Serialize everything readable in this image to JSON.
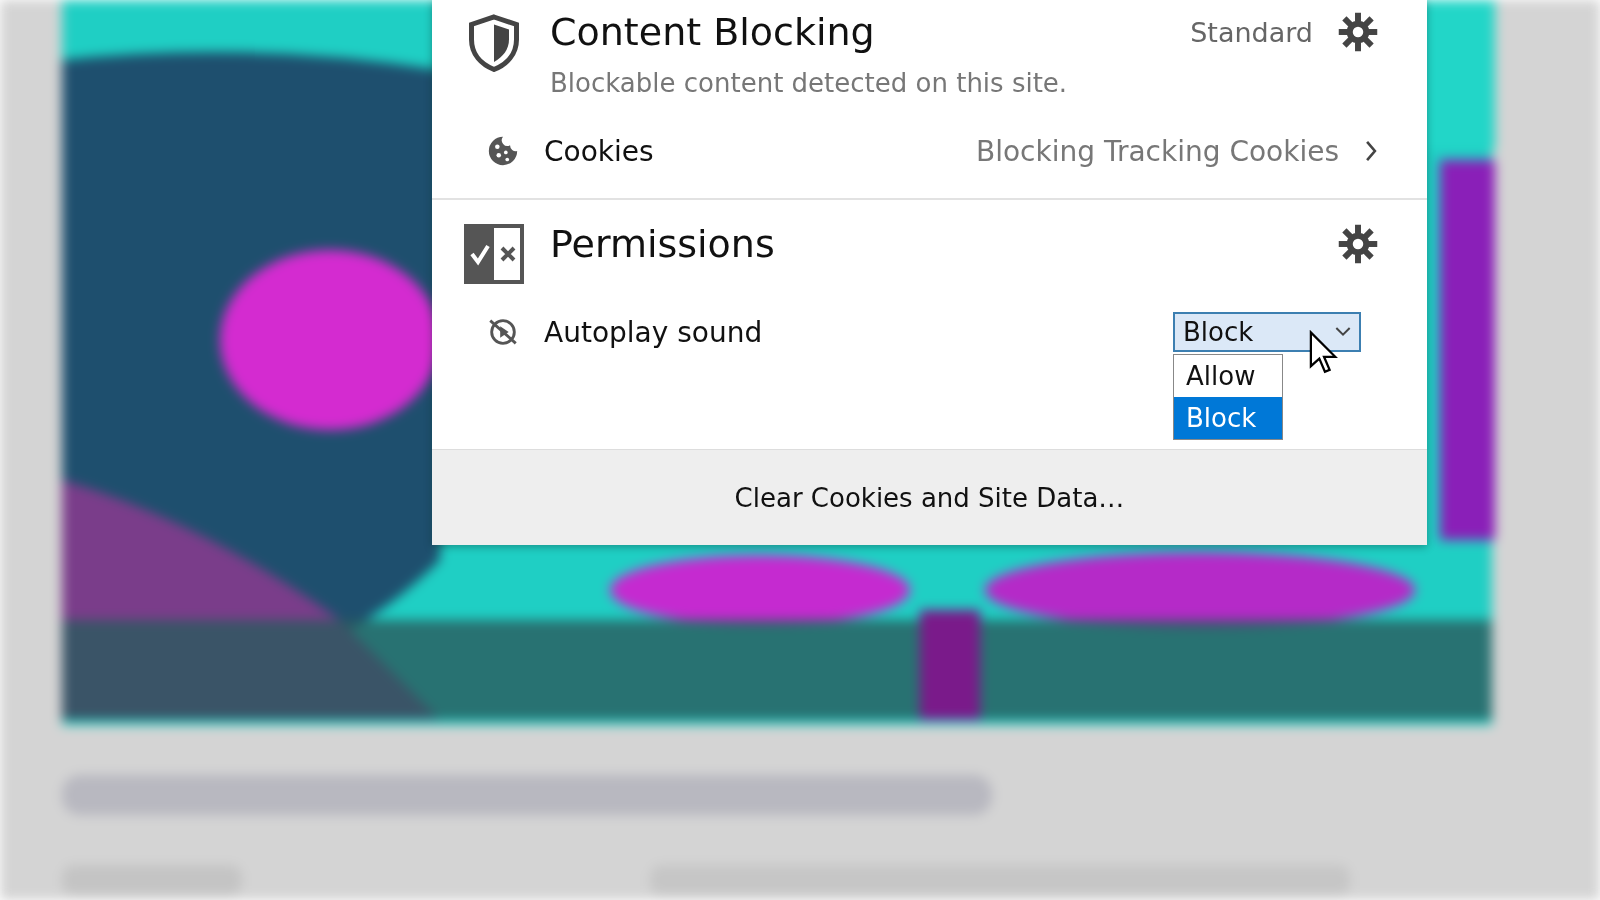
{
  "content_blocking": {
    "title": "Content Blocking",
    "mode": "Standard",
    "description": "Blockable content detected on this site.",
    "items": [
      {
        "label": "Cookies",
        "value": "Blocking Tracking Cookies"
      }
    ]
  },
  "permissions": {
    "title": "Permissions",
    "items": [
      {
        "label": "Autoplay sound",
        "value": "Block",
        "expanded": true,
        "options": [
          {
            "label": "Allow",
            "selected": false
          },
          {
            "label": "Block",
            "selected": true
          }
        ]
      }
    ]
  },
  "footer": {
    "button": "Clear Cookies and Site Data…"
  }
}
